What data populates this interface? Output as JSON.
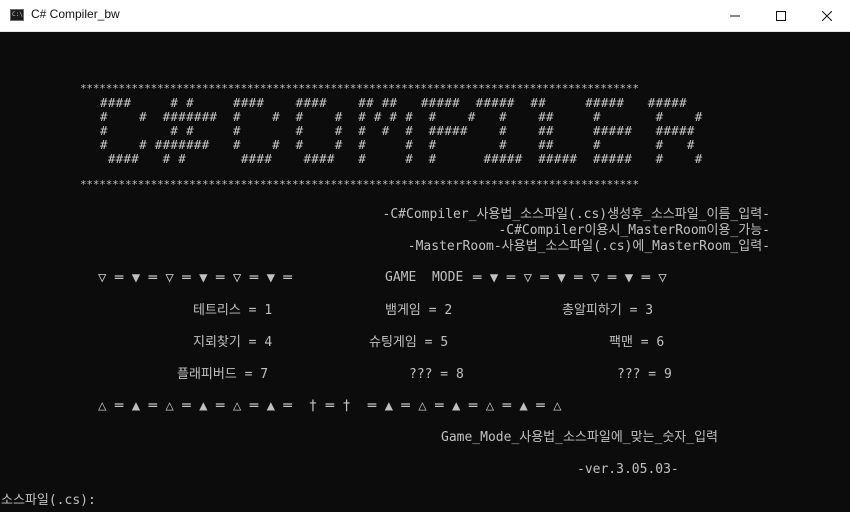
{
  "window": {
    "title": "C# Compiler_bw",
    "icon": "C:\\",
    "minimize_glyph": "—",
    "maximize_glyph": "☐",
    "close_glyph": "✕"
  },
  "banner": {
    "stars_top": "***************************************************************************************",
    "stars_bottom": "***************************************************************************************",
    "art": [
      "####     # #     ####    ####    ## ##   #####  #####  ##     #####   #####",
      "#    #  #######  #    #  #    #  # # # #  #    #   #    ##     #       #    #",
      "#        # #     #       #    #  #  #  #  #####    #    ##     #####   #####",
      "#    # #######   #    #  #    #  #     #  #        #    ##     #       #   #",
      " ####   # #       ####    ####   #     #  #      #####  #####  #####   #    #"
    ]
  },
  "usage": {
    "line1": "-C#Compiler_사용법_소스파일(.cs)생성후_소스파일_이름_입력-",
    "line2": "-C#Compiler이용시_MasterRoom이용_가능-",
    "line3": "-MasterRoom-사용법_소스파일(.cs)에_MasterRoom_입력-"
  },
  "game_mode": {
    "header_left": "▽ ═ ▼ ═ ▽ ═ ▼ ═ ▽ ═ ▼ ═",
    "header_label": "GAME  MODE",
    "header_right": "═ ▼ ═ ▽ ═ ▼ ═ ▽ ═ ▼ ═ ▽",
    "games": [
      {
        "label": "테트리스 = 1"
      },
      {
        "label": "뱀게임 = 2"
      },
      {
        "label": "총알피하기 = 3"
      },
      {
        "label": "지뢰찾기 = 4"
      },
      {
        "label": "슈팅게임 = 5"
      },
      {
        "label": "팩맨 = 6"
      },
      {
        "label": "플래피버드 = 7"
      },
      {
        "label": "??? = 8"
      },
      {
        "label": "??? = 9"
      }
    ],
    "footer": "△ ═ ▲ ═ △ ═ ▲ ═ △ ═ ▲ ═  † ═ †  ═ ▲ ═ △ ═ ▲ ═ △ ═ ▲ ═ △",
    "instruction": "Game_Mode_사용법_소스파일에_맞는_숫자_입력",
    "version": "-ver.3.05.03-"
  },
  "prompt": {
    "label": "소스파일(.cs):",
    "value": ""
  }
}
